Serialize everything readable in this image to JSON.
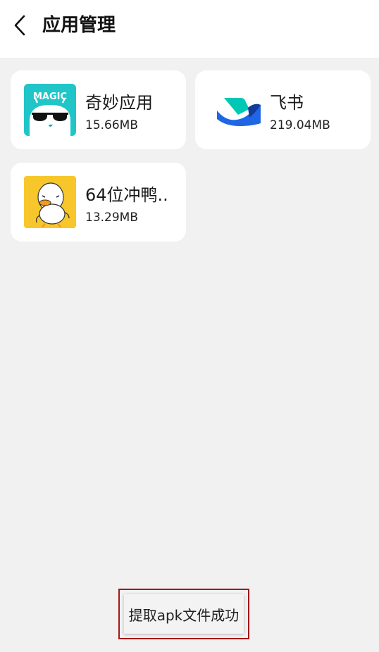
{
  "header": {
    "title": "应用管理",
    "back_icon": "chevron-left-icon"
  },
  "apps": [
    {
      "name": "奇妙应用",
      "size": "15.66MB",
      "icon": "magic-app-icon",
      "icon_text": "MAGIC",
      "color": "#20c5c8"
    },
    {
      "name": "飞书",
      "size": "219.04MB",
      "icon": "feishu-icon",
      "color": "#1f66e5"
    },
    {
      "name": "64位冲鸭..",
      "size": "13.29MB",
      "icon": "duck-icon",
      "color": "#f7c62a"
    }
  ],
  "toast": {
    "text": "提取apk文件成功"
  }
}
